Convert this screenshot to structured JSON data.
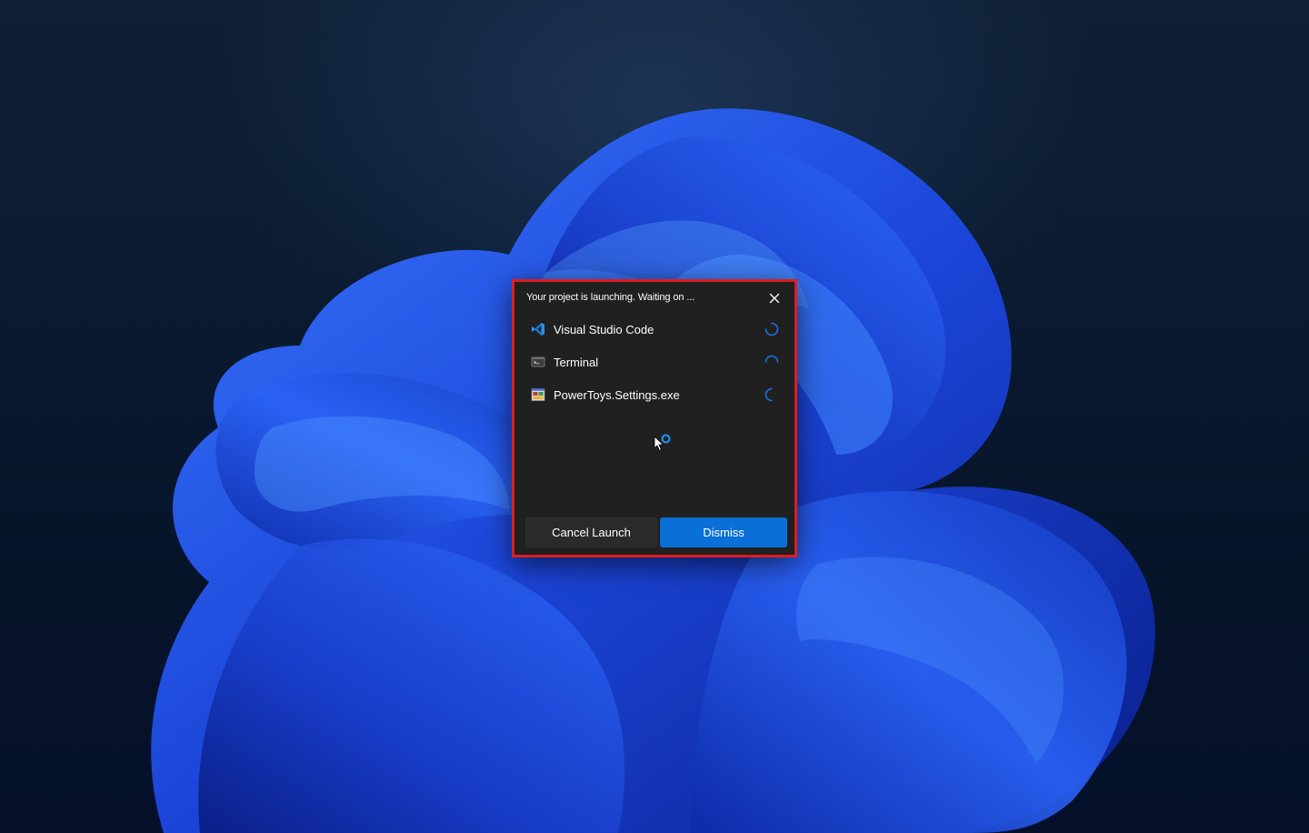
{
  "desktop": {
    "wallpaper_icon": "windows-bloom-wallpaper",
    "accent_color": "#1f4fe0"
  },
  "launch_dialog": {
    "title": "Your project is launching. Waiting on ...",
    "close_icon": "close-icon",
    "border_color": "#e01c1c",
    "apps": [
      {
        "label": "Visual Studio Code",
        "icon": "vscode-icon",
        "status_icon": "loading-spinner-icon"
      },
      {
        "label": "Terminal",
        "icon": "terminal-icon",
        "status_icon": "loading-spinner-icon"
      },
      {
        "label": "PowerToys.Settings.exe",
        "icon": "exe-app-icon",
        "status_icon": "loading-spinner-icon"
      }
    ],
    "cancel_label": "Cancel Launch",
    "dismiss_label": "Dismiss",
    "dismiss_color": "#0a6fd6"
  },
  "cursor": {
    "icon": "busy-cursor-icon"
  }
}
